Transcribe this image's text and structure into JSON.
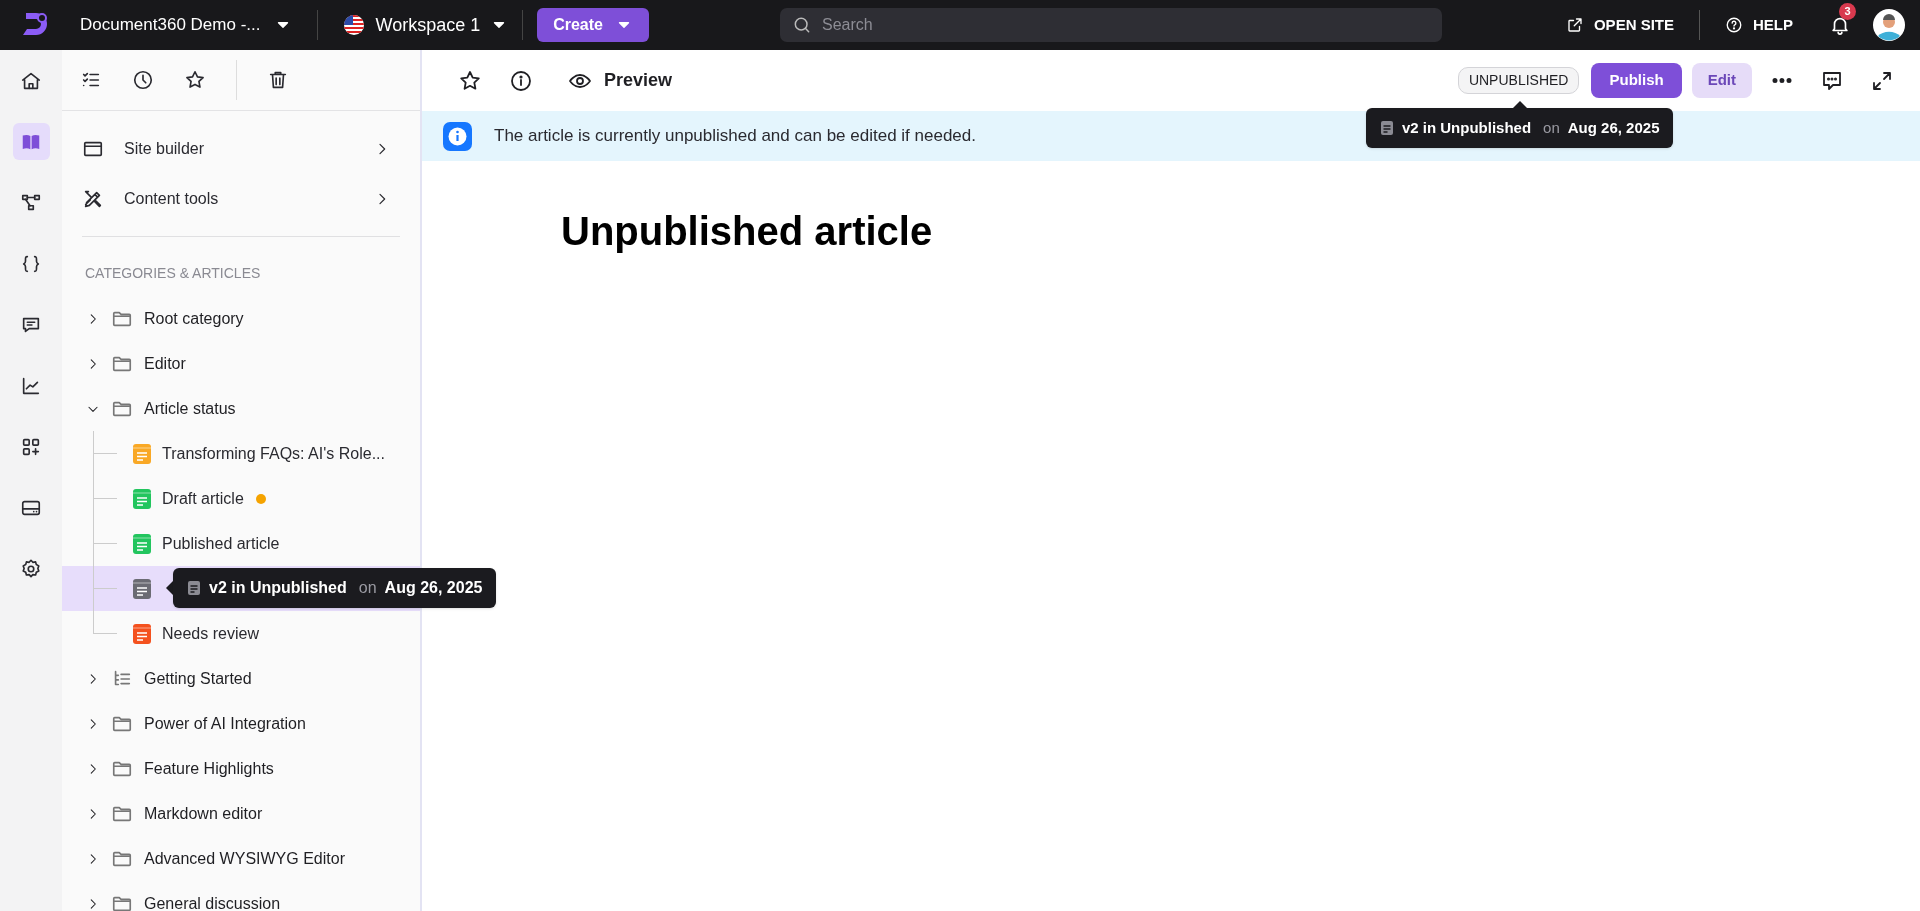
{
  "top_bar": {
    "project": "Document360 Demo -...",
    "workspace": "Workspace 1",
    "create": "Create",
    "search": {
      "placeholder": "Search"
    },
    "open_site": "OPEN SITE",
    "help": "HELP",
    "notifications": "3"
  },
  "rail": [
    {
      "selected": false
    },
    {
      "selected": true
    },
    {
      "selected": false
    },
    {
      "selected": false
    },
    {
      "selected": false
    },
    {
      "selected": false
    },
    {
      "selected": false
    },
    {
      "selected": false
    },
    {
      "selected": false
    }
  ],
  "sidebar": {
    "menu": [
      {
        "label": "Site builder"
      },
      {
        "label": "Content tools"
      }
    ],
    "section_title": "CATEGORIES & ARTICLES",
    "tree": [
      {
        "kind": "folder",
        "label": "Root category",
        "expanded": false
      },
      {
        "kind": "folder",
        "label": "Editor",
        "expanded": false
      },
      {
        "kind": "folder",
        "label": "Article status",
        "expanded": true,
        "children": [
          {
            "kind": "article",
            "label": "Transforming FAQs: AI's Role...",
            "color": "#f9a825",
            "selected": false,
            "unsaved": false
          },
          {
            "kind": "article",
            "label": "Draft article",
            "color": "#22c55e",
            "selected": false,
            "unsaved": true
          },
          {
            "kind": "article",
            "label": "Published article",
            "color": "#22c55e",
            "selected": false,
            "unsaved": false
          },
          {
            "kind": "article",
            "color": "#6b6b73",
            "selected": true,
            "unsaved": false,
            "tooltip": {
              "version": "v2 in Unpublished",
              "on": "on",
              "date": "Aug 26, 2025"
            }
          },
          {
            "kind": "article",
            "label": "Needs review",
            "color": "#f4511e",
            "selected": false,
            "unsaved": false
          }
        ]
      },
      {
        "kind": "index",
        "label": "Getting Started",
        "expanded": false
      },
      {
        "kind": "folder",
        "label": "Power of AI Integration",
        "expanded": false
      },
      {
        "kind": "folder",
        "label": "Feature Highlights",
        "expanded": false
      },
      {
        "kind": "folder",
        "label": "Markdown editor",
        "expanded": false
      },
      {
        "kind": "folder",
        "label": "Advanced WYSIWYG Editor",
        "expanded": false
      },
      {
        "kind": "folder",
        "label": "General discussion",
        "expanded": false
      }
    ]
  },
  "article": {
    "toolbar": {
      "preview": "Preview",
      "status": "UNPUBLISHED",
      "publish": "Publish",
      "edit": "Edit",
      "status_tooltip": {
        "version": "v2 in Unpublished",
        "on": "on",
        "date": "Aug 26, 2025"
      }
    },
    "banner": "The article is currently unpublished and can be edited if needed.",
    "title": "Unpublished article"
  }
}
